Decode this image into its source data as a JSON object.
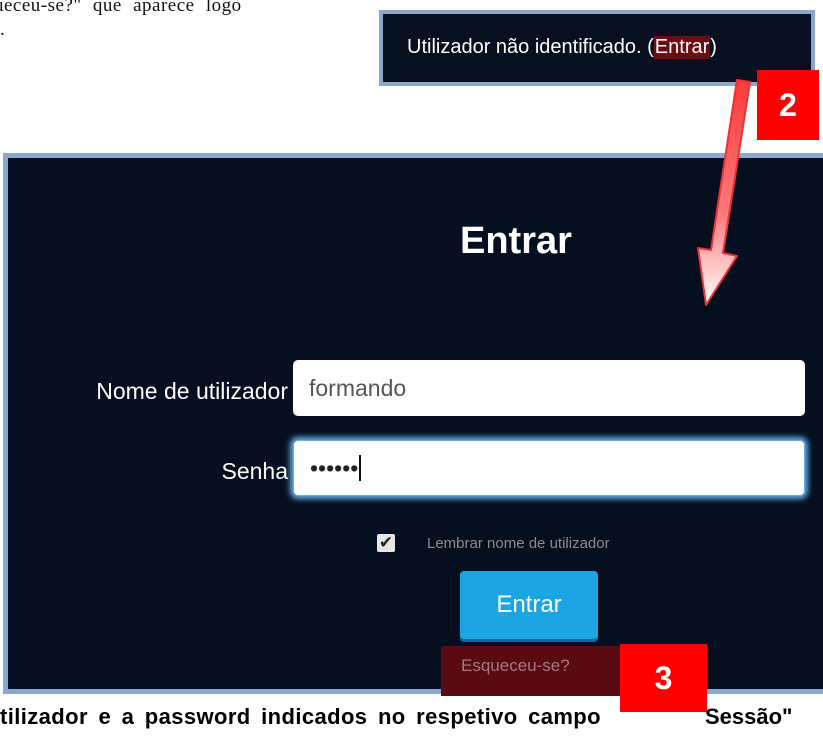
{
  "document": {
    "top_text_line1": "ueceu-se?\" que aparece logo",
    "top_text_line2": ".",
    "bottom_text_left": "tilizador e a password indicados no respetivo campo",
    "bottom_text_right": "Sessão\""
  },
  "header": {
    "status_prefix": "Utilizador não identificado. (",
    "login_link": "Entrar",
    "status_suffix": ")"
  },
  "badges": {
    "step2": "2",
    "step3": "3"
  },
  "login": {
    "title": "Entrar",
    "username_label": "Nome de utilizador",
    "username_value": "formando",
    "password_label": "Senha",
    "password_value": "••••••",
    "remember_checked": true,
    "remember_label": "Lembrar nome de utilizador",
    "submit_label": "Entrar",
    "forgot_label": "Esqueceu-se?"
  },
  "colors": {
    "panel_bg": "#050f20",
    "panel_border": "#8aa7cf",
    "badge_red": "#ff0000",
    "button_blue": "#1ba5e3",
    "highlight_dark_red": "#6b0d14"
  },
  "icons": {
    "checkbox": "check-icon",
    "arrow": "red-arrow-icon"
  }
}
